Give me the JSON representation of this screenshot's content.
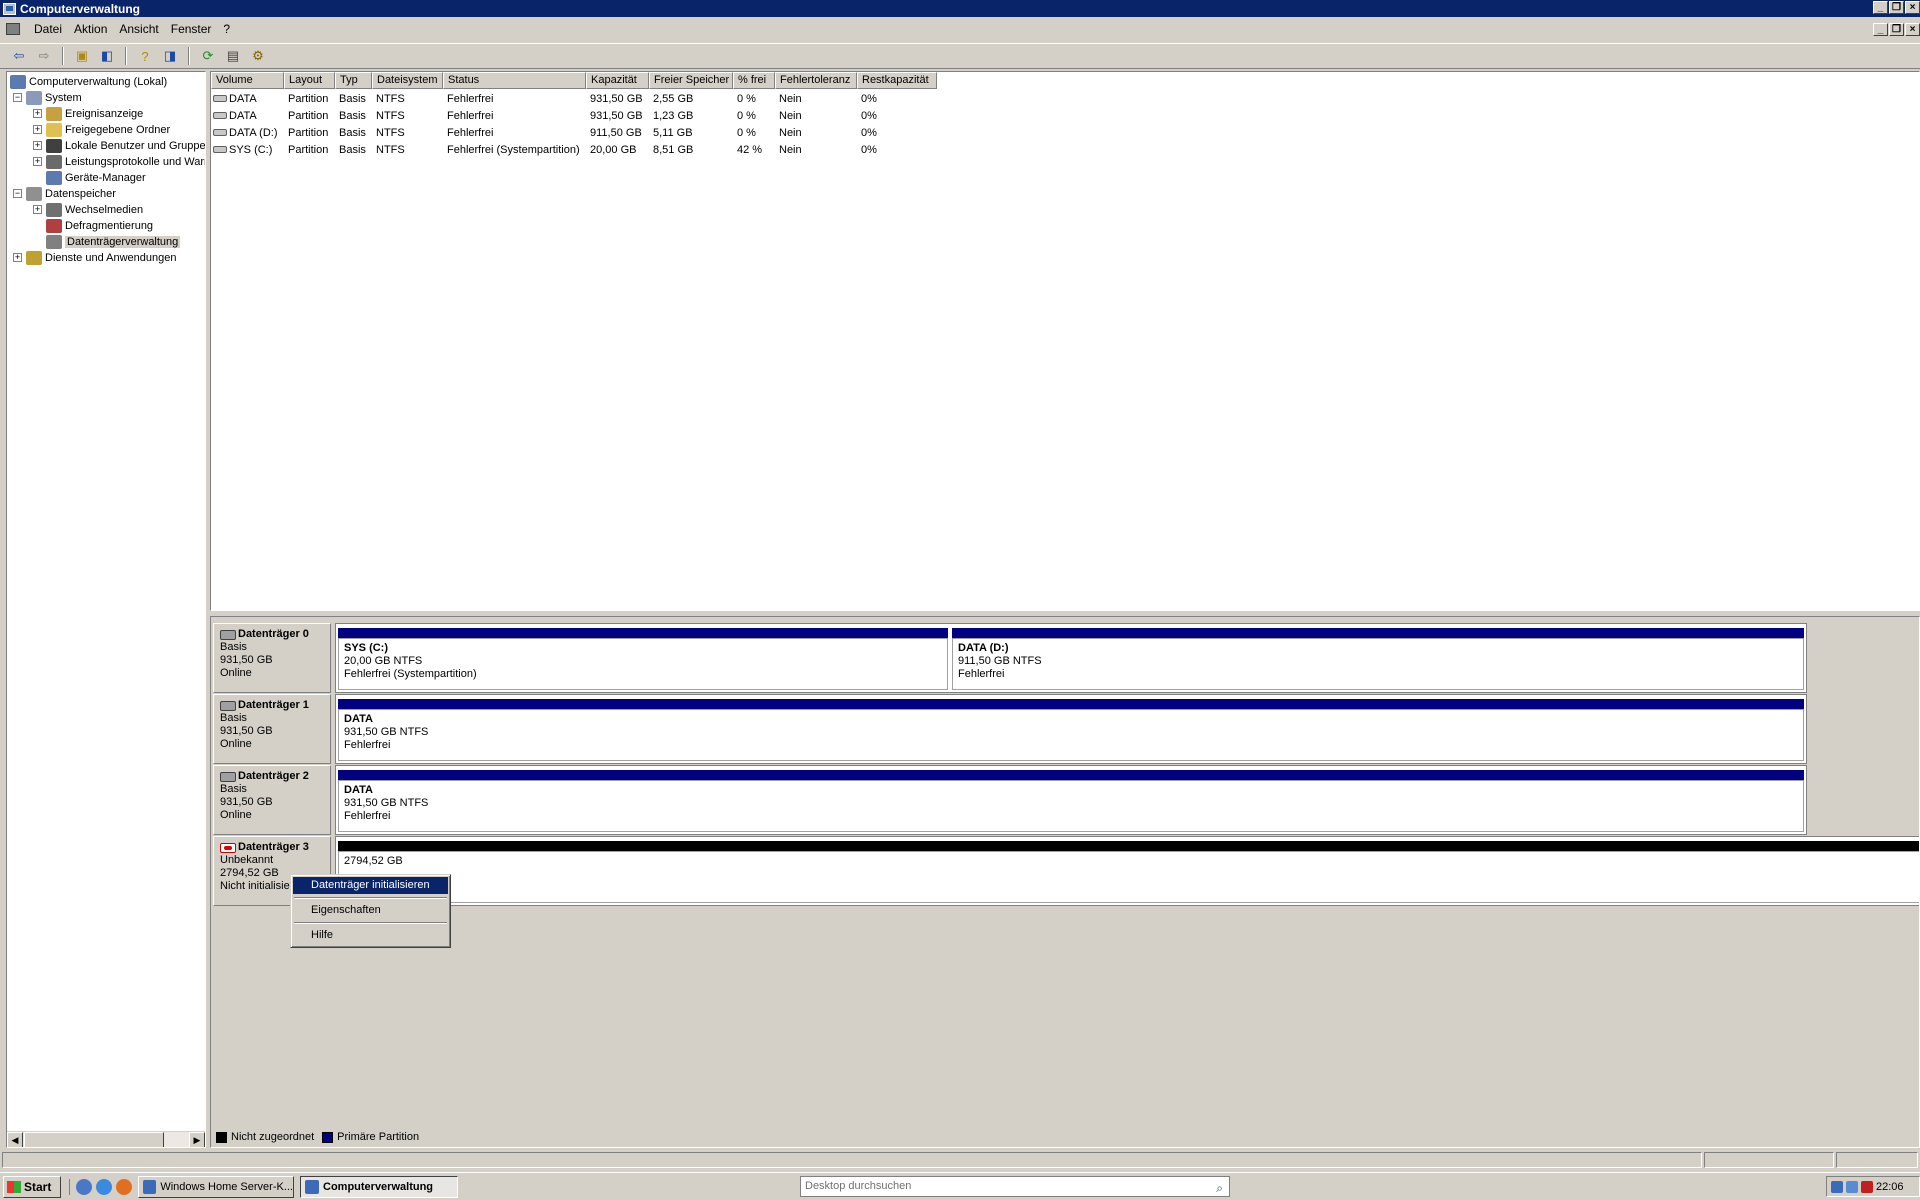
{
  "window": {
    "title": "Computerverwaltung"
  },
  "menubar": {
    "items": [
      {
        "label": "Datei",
        "accel": "D"
      },
      {
        "label": "Aktion",
        "accel": "k"
      },
      {
        "label": "Ansicht",
        "accel": "n"
      },
      {
        "label": "Fenster",
        "accel": "F"
      },
      {
        "label": "?",
        "accel": ""
      }
    ]
  },
  "tree": {
    "root": "Computerverwaltung (Lokal)",
    "items": [
      {
        "label": "System",
        "level": 1,
        "expander": "−"
      },
      {
        "label": "Ereignisanzeige",
        "level": 2,
        "expander": "+"
      },
      {
        "label": "Freigegebene Ordner",
        "level": 2,
        "expander": "+"
      },
      {
        "label": "Lokale Benutzer und Gruppen",
        "level": 2,
        "expander": "+"
      },
      {
        "label": "Leistungsprotokolle und Warnungen",
        "level": 2,
        "expander": "+"
      },
      {
        "label": "Geräte-Manager",
        "level": 2,
        "expander": ""
      },
      {
        "label": "Datenspeicher",
        "level": 1,
        "expander": "−"
      },
      {
        "label": "Wechselmedien",
        "level": 2,
        "expander": "+"
      },
      {
        "label": "Defragmentierung",
        "level": 2,
        "expander": ""
      },
      {
        "label": "Datenträgerverwaltung",
        "level": 2,
        "expander": "",
        "selected": true
      },
      {
        "label": "Dienste und Anwendungen",
        "level": 1,
        "expander": "+"
      }
    ]
  },
  "volume_list": {
    "columns": [
      "Volume",
      "Layout",
      "Typ",
      "Dateisystem",
      "Status",
      "Kapazität",
      "Freier Speicher",
      "% frei",
      "Fehlertoleranz",
      "Restkapazität"
    ],
    "rows": [
      [
        "DATA",
        "Partition",
        "Basis",
        "NTFS",
        "Fehlerfrei",
        "931,50 GB",
        "2,55 GB",
        "0 %",
        "Nein",
        "0%"
      ],
      [
        "DATA",
        "Partition",
        "Basis",
        "NTFS",
        "Fehlerfrei",
        "931,50 GB",
        "1,23 GB",
        "0 %",
        "Nein",
        "0%"
      ],
      [
        "DATA (D:)",
        "Partition",
        "Basis",
        "NTFS",
        "Fehlerfrei",
        "911,50 GB",
        "5,11 GB",
        "0 %",
        "Nein",
        "0%"
      ],
      [
        "SYS (C:)",
        "Partition",
        "Basis",
        "NTFS",
        "Fehlerfrei (Systempartition)",
        "20,00 GB",
        "8,51 GB",
        "42 %",
        "Nein",
        "0%"
      ]
    ]
  },
  "disks": [
    {
      "name": "Datenträger 0",
      "type": "Basis",
      "size": "931,50 GB",
      "state": "Online",
      "error": false,
      "partitions": [
        {
          "title": "SYS  (C:)",
          "size": "20,00 GB NTFS",
          "status": "Fehlerfrei (Systempartition)",
          "kind": "primary"
        },
        {
          "title": "DATA  (D:)",
          "size": "911,50 GB NTFS",
          "status": "Fehlerfrei",
          "kind": "primary"
        }
      ]
    },
    {
      "name": "Datenträger 1",
      "type": "Basis",
      "size": "931,50 GB",
      "state": "Online",
      "error": false,
      "partitions": [
        {
          "title": "DATA",
          "size": "931,50 GB NTFS",
          "status": "Fehlerfrei",
          "kind": "primary"
        }
      ]
    },
    {
      "name": "Datenträger 2",
      "type": "Basis",
      "size": "931,50 GB",
      "state": "Online",
      "error": false,
      "partitions": [
        {
          "title": "DATA",
          "size": "931,50 GB NTFS",
          "status": "Fehlerfrei",
          "kind": "primary"
        }
      ]
    },
    {
      "name": "Datenträger 3",
      "type": "Unbekannt",
      "size": "2794,52 GB",
      "state": "Nicht initialisiert",
      "error": true,
      "partitions": [
        {
          "title": "",
          "size": "2794,52 GB",
          "status": "",
          "kind": "unalloc"
        }
      ]
    }
  ],
  "context_menu": {
    "items": [
      "Datenträger initialisieren",
      "Eigenschaften",
      "Hilfe"
    ],
    "active_index": 0
  },
  "legend": {
    "items": [
      {
        "label": "Nicht zugeordnet",
        "color": "#000000"
      },
      {
        "label": "Primäre Partition",
        "color": "#000080"
      }
    ]
  },
  "taskbar": {
    "start_label": "Start",
    "tasks": [
      {
        "label": "Windows Home Server-K...",
        "active": false
      },
      {
        "label": "Computerverwaltung",
        "active": true
      }
    ],
    "search_placeholder": "Desktop durchsuchen",
    "clock": "22:06"
  },
  "colors": {
    "title_bar": "#0a246a",
    "primary_partition": "#000080",
    "unallocated": "#000000",
    "menu_highlight": "#0a246a"
  }
}
